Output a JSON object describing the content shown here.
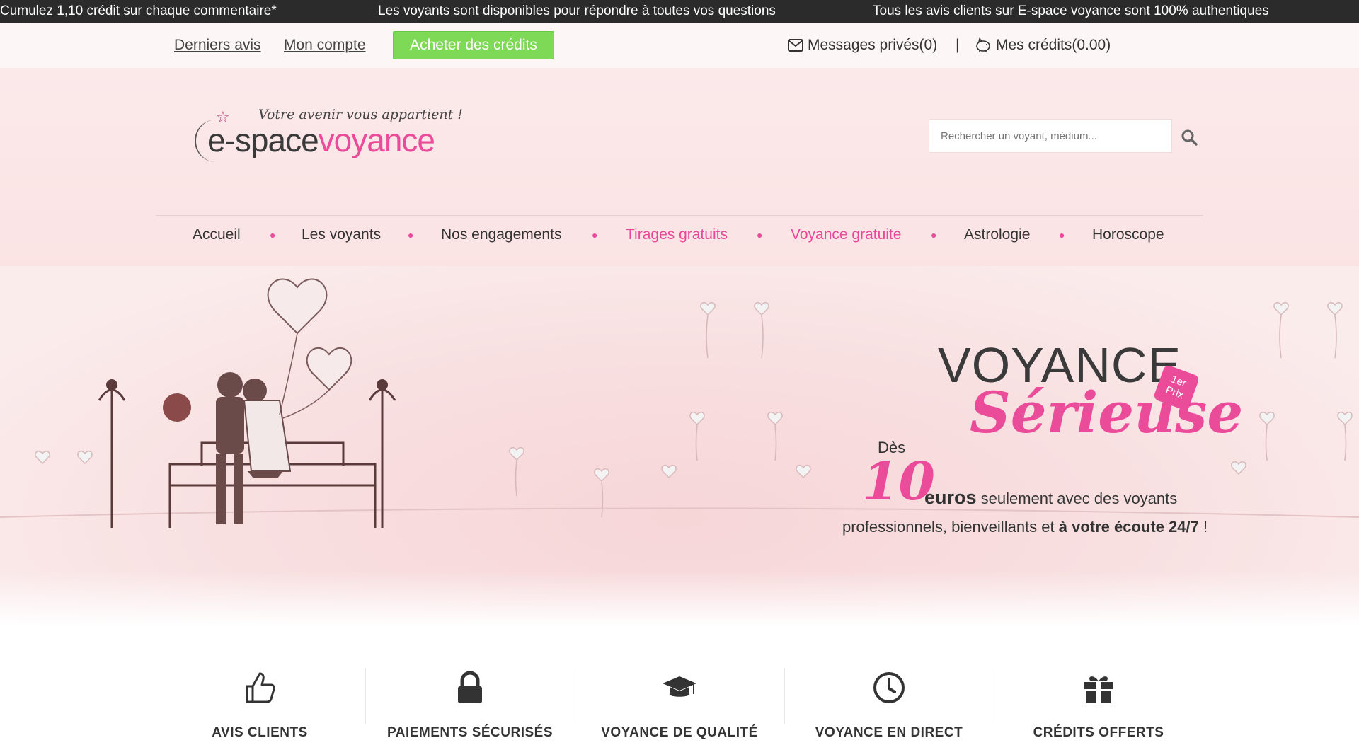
{
  "ticker": {
    "msg1": "Cumulez 1,10 crédit sur chaque commentaire*",
    "msg2": "Les voyants sont disponibles pour répondre à toutes vos questions",
    "msg3": "Tous les avis clients sur E-space voyance sont 100% authentiques"
  },
  "topbar": {
    "latest_reviews": "Derniers avis",
    "my_account": "Mon compte",
    "buy_credits": "Acheter des crédits",
    "messages": "Messages privés(0)",
    "separator": "|",
    "credits": "Mes crédits(0.00)"
  },
  "logo": {
    "tagline": "Votre avenir vous appartient !",
    "brand_dark": "e-space",
    "brand_pink": "voyance"
  },
  "search": {
    "placeholder": "Rechercher un voyant, médium..."
  },
  "nav": {
    "items": [
      "Accueil",
      "Les voyants",
      "Nos engagements",
      "Tirages gratuits",
      "Voyance gratuite",
      "Astrologie",
      "Horoscope"
    ]
  },
  "hero": {
    "title": "VOYANCE",
    "badge_line1": "1er",
    "badge_line2": "Prix",
    "script": "Sérieuse",
    "from": "Dès",
    "amount": "10",
    "currency": "euros",
    "line1_rest": "seulement avec des voyants",
    "line2_a": "professionnels, bienveillants et",
    "line2_b": "à votre écoute 24/7",
    "line2_end": " !"
  },
  "features": [
    {
      "label": "AVIS CLIENTS",
      "icon": "thumbs-up-icon"
    },
    {
      "label": "PAIEMENTS SÉCURISÉS",
      "icon": "lock-icon"
    },
    {
      "label": "VOYANCE DE QUALITÉ",
      "icon": "graduation-cap-icon"
    },
    {
      "label": "VOYANCE EN DIRECT",
      "icon": "clock-icon"
    },
    {
      "label": "CRÉDITS OFFERTS",
      "icon": "gift-icon"
    }
  ],
  "colors": {
    "accent_pink": "#ea4c9a",
    "button_green": "#7ed957",
    "ticker_bg": "#2b2b2b"
  }
}
